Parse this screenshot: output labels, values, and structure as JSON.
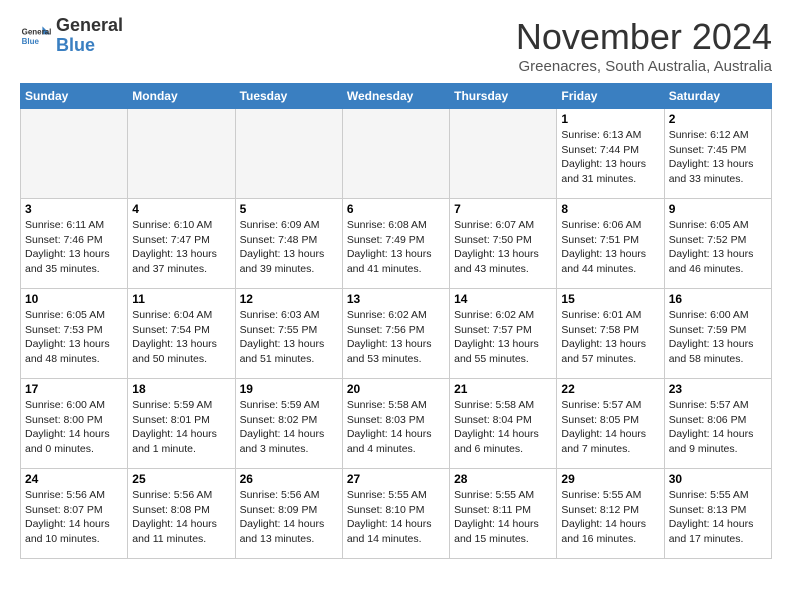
{
  "header": {
    "logo_line1": "General",
    "logo_line2": "Blue",
    "month_title": "November 2024",
    "location": "Greenacres, South Australia, Australia"
  },
  "weekdays": [
    "Sunday",
    "Monday",
    "Tuesday",
    "Wednesday",
    "Thursday",
    "Friday",
    "Saturday"
  ],
  "weeks": [
    [
      {
        "day": "",
        "empty": true
      },
      {
        "day": "",
        "empty": true
      },
      {
        "day": "",
        "empty": true
      },
      {
        "day": "",
        "empty": true
      },
      {
        "day": "",
        "empty": true
      },
      {
        "day": "1",
        "info": "Sunrise: 6:13 AM\nSunset: 7:44 PM\nDaylight: 13 hours\nand 31 minutes."
      },
      {
        "day": "2",
        "info": "Sunrise: 6:12 AM\nSunset: 7:45 PM\nDaylight: 13 hours\nand 33 minutes."
      }
    ],
    [
      {
        "day": "3",
        "info": "Sunrise: 6:11 AM\nSunset: 7:46 PM\nDaylight: 13 hours\nand 35 minutes."
      },
      {
        "day": "4",
        "info": "Sunrise: 6:10 AM\nSunset: 7:47 PM\nDaylight: 13 hours\nand 37 minutes."
      },
      {
        "day": "5",
        "info": "Sunrise: 6:09 AM\nSunset: 7:48 PM\nDaylight: 13 hours\nand 39 minutes."
      },
      {
        "day": "6",
        "info": "Sunrise: 6:08 AM\nSunset: 7:49 PM\nDaylight: 13 hours\nand 41 minutes."
      },
      {
        "day": "7",
        "info": "Sunrise: 6:07 AM\nSunset: 7:50 PM\nDaylight: 13 hours\nand 43 minutes."
      },
      {
        "day": "8",
        "info": "Sunrise: 6:06 AM\nSunset: 7:51 PM\nDaylight: 13 hours\nand 44 minutes."
      },
      {
        "day": "9",
        "info": "Sunrise: 6:05 AM\nSunset: 7:52 PM\nDaylight: 13 hours\nand 46 minutes."
      }
    ],
    [
      {
        "day": "10",
        "info": "Sunrise: 6:05 AM\nSunset: 7:53 PM\nDaylight: 13 hours\nand 48 minutes."
      },
      {
        "day": "11",
        "info": "Sunrise: 6:04 AM\nSunset: 7:54 PM\nDaylight: 13 hours\nand 50 minutes."
      },
      {
        "day": "12",
        "info": "Sunrise: 6:03 AM\nSunset: 7:55 PM\nDaylight: 13 hours\nand 51 minutes."
      },
      {
        "day": "13",
        "info": "Sunrise: 6:02 AM\nSunset: 7:56 PM\nDaylight: 13 hours\nand 53 minutes."
      },
      {
        "day": "14",
        "info": "Sunrise: 6:02 AM\nSunset: 7:57 PM\nDaylight: 13 hours\nand 55 minutes."
      },
      {
        "day": "15",
        "info": "Sunrise: 6:01 AM\nSunset: 7:58 PM\nDaylight: 13 hours\nand 57 minutes."
      },
      {
        "day": "16",
        "info": "Sunrise: 6:00 AM\nSunset: 7:59 PM\nDaylight: 13 hours\nand 58 minutes."
      }
    ],
    [
      {
        "day": "17",
        "info": "Sunrise: 6:00 AM\nSunset: 8:00 PM\nDaylight: 14 hours\nand 0 minutes."
      },
      {
        "day": "18",
        "info": "Sunrise: 5:59 AM\nSunset: 8:01 PM\nDaylight: 14 hours\nand 1 minute."
      },
      {
        "day": "19",
        "info": "Sunrise: 5:59 AM\nSunset: 8:02 PM\nDaylight: 14 hours\nand 3 minutes."
      },
      {
        "day": "20",
        "info": "Sunrise: 5:58 AM\nSunset: 8:03 PM\nDaylight: 14 hours\nand 4 minutes."
      },
      {
        "day": "21",
        "info": "Sunrise: 5:58 AM\nSunset: 8:04 PM\nDaylight: 14 hours\nand 6 minutes."
      },
      {
        "day": "22",
        "info": "Sunrise: 5:57 AM\nSunset: 8:05 PM\nDaylight: 14 hours\nand 7 minutes."
      },
      {
        "day": "23",
        "info": "Sunrise: 5:57 AM\nSunset: 8:06 PM\nDaylight: 14 hours\nand 9 minutes."
      }
    ],
    [
      {
        "day": "24",
        "info": "Sunrise: 5:56 AM\nSunset: 8:07 PM\nDaylight: 14 hours\nand 10 minutes."
      },
      {
        "day": "25",
        "info": "Sunrise: 5:56 AM\nSunset: 8:08 PM\nDaylight: 14 hours\nand 11 minutes."
      },
      {
        "day": "26",
        "info": "Sunrise: 5:56 AM\nSunset: 8:09 PM\nDaylight: 14 hours\nand 13 minutes."
      },
      {
        "day": "27",
        "info": "Sunrise: 5:55 AM\nSunset: 8:10 PM\nDaylight: 14 hours\nand 14 minutes."
      },
      {
        "day": "28",
        "info": "Sunrise: 5:55 AM\nSunset: 8:11 PM\nDaylight: 14 hours\nand 15 minutes."
      },
      {
        "day": "29",
        "info": "Sunrise: 5:55 AM\nSunset: 8:12 PM\nDaylight: 14 hours\nand 16 minutes."
      },
      {
        "day": "30",
        "info": "Sunrise: 5:55 AM\nSunset: 8:13 PM\nDaylight: 14 hours\nand 17 minutes."
      }
    ]
  ]
}
